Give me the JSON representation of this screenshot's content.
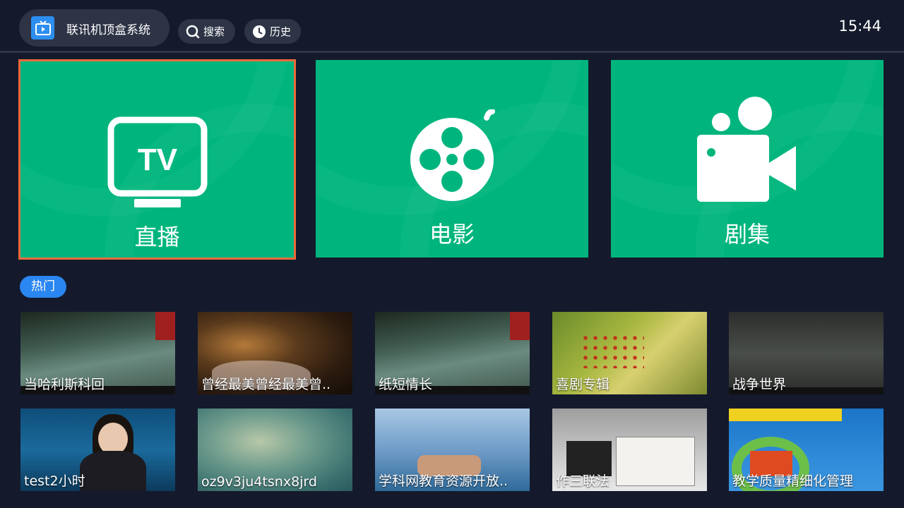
{
  "header": {
    "app_title": "联讯机顶盒系统",
    "search_label": "搜索",
    "history_label": "历史",
    "clock": "15:44"
  },
  "tiles": [
    {
      "label": "直播",
      "icon": "tv-icon",
      "tv_text": "TV"
    },
    {
      "label": "电影",
      "icon": "film-reel-icon"
    },
    {
      "label": "剧集",
      "icon": "video-camera-icon"
    }
  ],
  "hot": {
    "badge": "热门",
    "items": [
      {
        "title": "当哈利斯科回"
      },
      {
        "title": "曾经最美曾经最美曾.."
      },
      {
        "title": "纸短情长"
      },
      {
        "title": "喜剧专辑"
      },
      {
        "title": "战争世界"
      },
      {
        "title": "test2小时"
      },
      {
        "title": "oz9v3ju4tsnx8jrd"
      },
      {
        "title": "学科网教育资源开放.."
      },
      {
        "title": "作三联法"
      },
      {
        "title": "教学质量精细化管理"
      }
    ]
  },
  "colors": {
    "background": "#141a2c",
    "tile_green": "#00b57d",
    "focus_border": "#f06a3c",
    "accent_blue": "#2a86f0"
  }
}
